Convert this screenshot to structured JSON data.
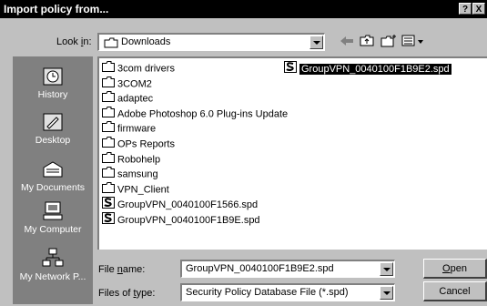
{
  "dialog": {
    "title": "Import policy from...",
    "help_button": "?",
    "close_button": "X"
  },
  "look_in": {
    "label_pre": "Look ",
    "label_acc": "i",
    "label_post": "n:",
    "value": "Downloads"
  },
  "places": [
    {
      "label": "History",
      "icon": "history-icon"
    },
    {
      "label": "Desktop",
      "icon": "desktop-icon"
    },
    {
      "label": "My Documents",
      "icon": "my-documents-icon"
    },
    {
      "label": "My Computer",
      "icon": "my-computer-icon"
    },
    {
      "label": "My Network P...",
      "icon": "network-icon"
    }
  ],
  "files": [
    {
      "name": "3com drivers",
      "type": "folder"
    },
    {
      "name": "3COM2",
      "type": "folder"
    },
    {
      "name": "adaptec",
      "type": "folder"
    },
    {
      "name": "Adobe Photoshop 6.0 Plug-ins Update",
      "type": "folder"
    },
    {
      "name": "firmware",
      "type": "folder"
    },
    {
      "name": "OPs Reports",
      "type": "folder"
    },
    {
      "name": "Robohelp",
      "type": "folder"
    },
    {
      "name": "samsung",
      "type": "folder"
    },
    {
      "name": "VPN_Client",
      "type": "folder"
    },
    {
      "name": "GroupVPN_0040100F1566.spd",
      "type": "spd"
    },
    {
      "name": "GroupVPN_0040100F1B9E.spd",
      "type": "spd"
    },
    {
      "name": "GroupVPN_0040100F1B9E2.spd",
      "type": "spd",
      "selected": true
    }
  ],
  "file_name": {
    "label_pre": "File ",
    "label_acc": "n",
    "label_post": "ame:",
    "value": "GroupVPN_0040100F1B9E2.spd"
  },
  "files_of_type": {
    "label_pre": "Files of ",
    "label_acc": "t",
    "label_post": "ype:",
    "value": "Security Policy Database File (*.spd)"
  },
  "buttons": {
    "open_acc": "O",
    "open_rest": "pen",
    "cancel": "Cancel"
  }
}
